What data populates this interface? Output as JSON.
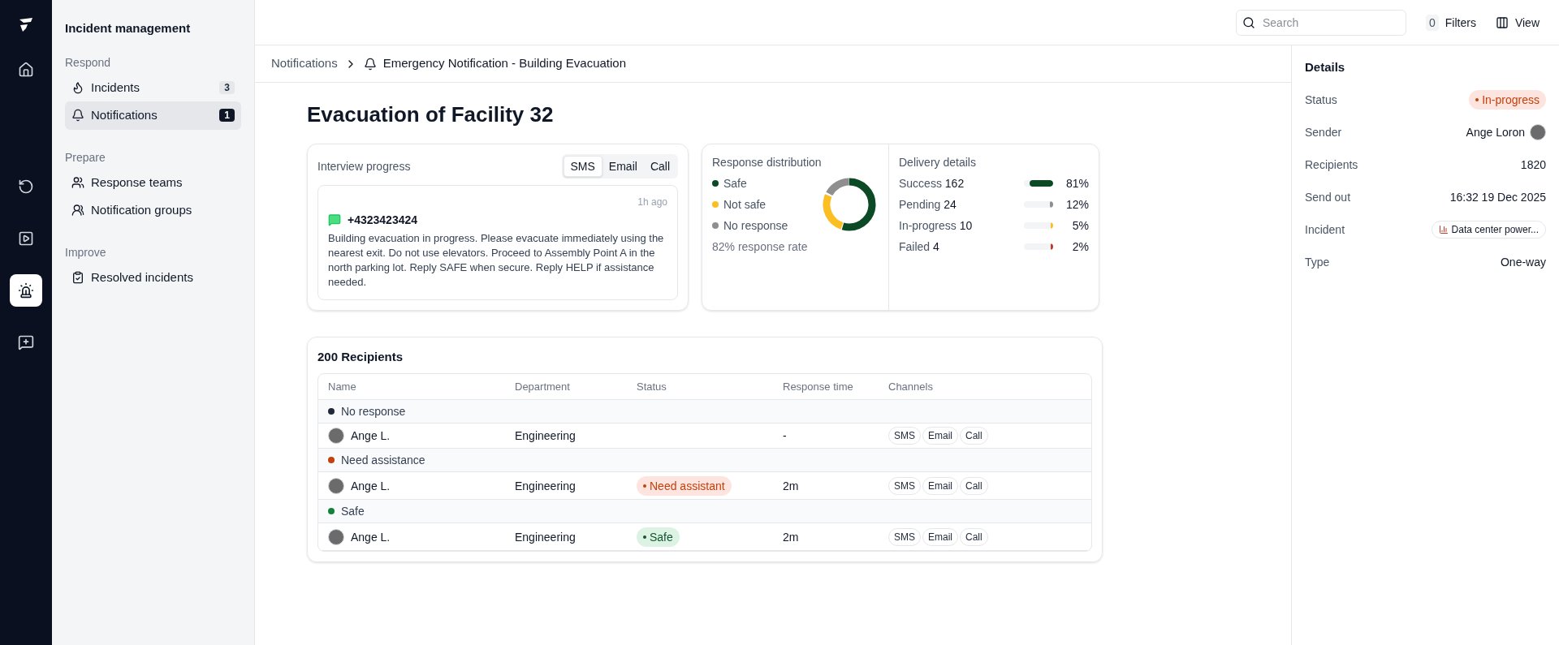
{
  "toolbar": {
    "search": {
      "placeholder": "Search"
    },
    "filters": {
      "count": "0",
      "label": "Filters"
    },
    "view": {
      "label": "View"
    }
  },
  "rail": [
    {
      "selected": false
    },
    {
      "selected": false
    },
    {
      "selected": false
    },
    {
      "selected": true
    },
    {
      "selected": false
    }
  ],
  "sidebar": {
    "title": "Incident management",
    "sections": [
      {
        "heading": "Respond",
        "items": [
          {
            "label": "Incidents",
            "count": "3",
            "selected": false
          },
          {
            "label": "Notifications",
            "count": "1",
            "selected": true
          }
        ]
      },
      {
        "heading": "Prepare",
        "items": [
          {
            "label": "Response teams",
            "selected": false
          },
          {
            "label": "Notification groups",
            "selected": false
          }
        ]
      },
      {
        "heading": "Improve",
        "items": [
          {
            "label": "Resolved incidents",
            "selected": false
          }
        ]
      }
    ]
  },
  "breadcrumb": [
    "Notifications",
    "Emergency Notification - Building Evacuation"
  ],
  "title": "Evacuation of Facility 32",
  "interview": {
    "title": "Interview progress",
    "tabs": [
      {
        "label": "SMS",
        "selected": true
      },
      {
        "label": "Email",
        "selected": false
      },
      {
        "label": "Call",
        "selected": false
      }
    ],
    "time": "1h ago",
    "sender": "+4323423424",
    "message": "Building evacuation in progress. Please evacuate immediately using the nearest exit. Do not use elevators. Proceed to Assembly Point A in the north parking lot. Reply SAFE when secure. Reply HELP if assistance needed."
  },
  "distribution": {
    "title": "Response distribution",
    "legend": [
      {
        "label": "Safe",
        "color": "#0b4a25"
      },
      {
        "label": "Not safe",
        "color": "#fbbf24"
      },
      {
        "label": "No response",
        "color": "#8f8f8f"
      }
    ],
    "rate": "82% response rate"
  },
  "delivery": {
    "title": "Delivery details",
    "rows": [
      {
        "label": "Success",
        "count": "162",
        "level": 0.81,
        "reading": "81%",
        "color": "#0b4a25"
      },
      {
        "label": "Pending",
        "count": "24",
        "level": 0.12,
        "reading": "12%",
        "color": "#8f8f8f"
      },
      {
        "label": "In-progress",
        "count": "10",
        "level": 0.05,
        "reading": "5%",
        "color": "#fbbf24"
      },
      {
        "label": "Failed",
        "count": "4",
        "level": 0.02,
        "reading": "2%",
        "color": "#c0392b"
      }
    ]
  },
  "recipients": {
    "title": "200 Recipients",
    "columns": [
      "Name",
      "Department",
      "Status",
      "Response time",
      "Channels"
    ],
    "groups": [
      {
        "label": "No response",
        "color": "#1f2937",
        "time": "-",
        "channels": [
          "SMS",
          "Email",
          "Call"
        ],
        "person": {
          "name": "Ange L.",
          "department": "Engineering"
        }
      },
      {
        "label": "Need assistance",
        "color": "#c2410c",
        "status": {
          "label": "Need assistant",
          "kind": "danger"
        },
        "time": "2m",
        "channels": [
          "SMS",
          "Email",
          "Call"
        ],
        "person": {
          "name": "Ange L.",
          "department": "Engineering"
        }
      },
      {
        "label": "Safe",
        "color": "#15803d",
        "status": {
          "label": "Safe",
          "kind": "success"
        },
        "time": "2m",
        "channels": [
          "SMS",
          "Email",
          "Call"
        ],
        "person": {
          "name": "Ange L.",
          "department": "Engineering"
        }
      }
    ]
  },
  "details": {
    "title": "Details",
    "fields": [
      {
        "label": "Status",
        "kind": "status",
        "value": "In-progress"
      },
      {
        "label": "Sender",
        "kind": "person",
        "value": "Ange Loron"
      },
      {
        "label": "Recipients",
        "kind": "text",
        "value": "1820"
      },
      {
        "label": "Send out",
        "kind": "text",
        "value": "16:32 19 Dec 2025"
      },
      {
        "label": "Incident",
        "kind": "incident",
        "value": "Data center power..."
      },
      {
        "label": "Type",
        "kind": "text",
        "value": "One-way"
      }
    ]
  }
}
